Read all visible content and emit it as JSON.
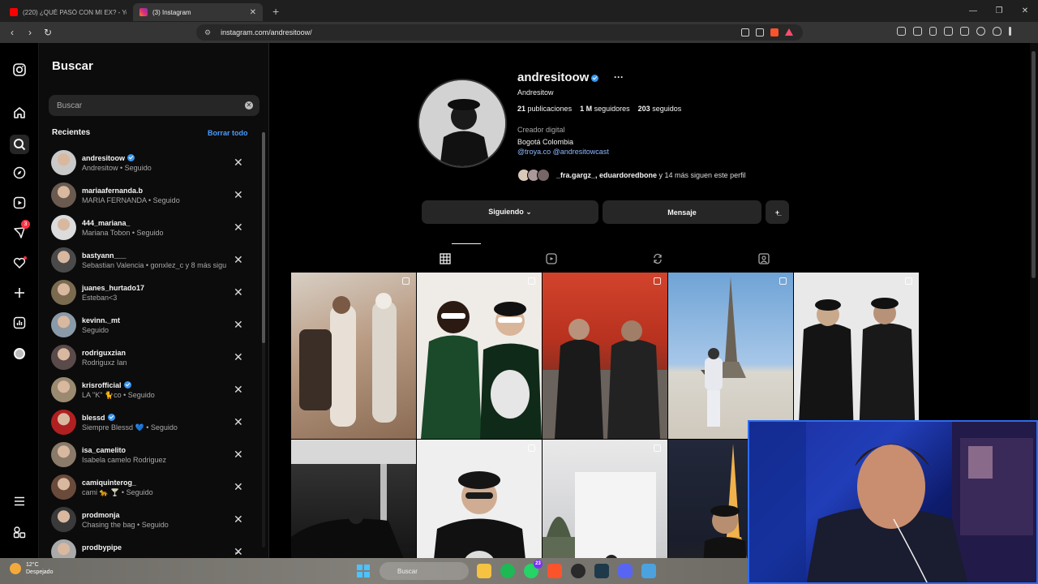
{
  "browser": {
    "tabs": [
      {
        "title": "(220) ¿QUÉ PASÓ CON MI EX? - YouTube",
        "fav_color": "#ff0000"
      },
      {
        "title": "(3) Instagram",
        "fav_color": "#e1306c"
      }
    ],
    "url": "instagram.com/andresitoow/"
  },
  "rail": {
    "notifications_badge": "3"
  },
  "search_panel": {
    "title": "Buscar",
    "placeholder": "Buscar",
    "recent_label": "Recientes",
    "clear_all": "Borrar todo",
    "items": [
      {
        "username": "andresitoow",
        "verified": true,
        "sub": "Andresitow • Seguido",
        "avatar": "#c9c9c9"
      },
      {
        "username": "mariaafernanda.b",
        "verified": false,
        "sub": "MARIA FERNANDA • Seguido",
        "avatar": "#6b5a4f"
      },
      {
        "username": "444_mariana_",
        "verified": false,
        "sub": "Mariana Tobon • Seguido",
        "avatar": "#dcdcdc"
      },
      {
        "username": "bastyann___",
        "verified": false,
        "sub": "Sebastian Valencia • gonxlez_c y 8 más siguen",
        "avatar": "#4a4a4a"
      },
      {
        "username": "juanes_hurtado17",
        "verified": false,
        "sub": "Esteban<3",
        "avatar": "#7a6a50"
      },
      {
        "username": "kevinn._mt",
        "verified": false,
        "sub": "Seguido",
        "avatar": "#8a9aa8"
      },
      {
        "username": "rodriguxzian",
        "verified": false,
        "sub": "Rodriguxz Ian",
        "avatar": "#5a4a4a"
      },
      {
        "username": "krisrofficial",
        "verified": true,
        "sub": "LA \"K\" 🐈co • Seguido",
        "avatar": "#9a8a70"
      },
      {
        "username": "blessd",
        "verified": true,
        "sub": "Siempre Blessd 💙 • Seguido",
        "avatar": "#b02020"
      },
      {
        "username": "isa_camelito",
        "verified": false,
        "sub": "Isabela camelo Rodriguez",
        "avatar": "#8a7a6a"
      },
      {
        "username": "camiquinterog_",
        "verified": false,
        "sub": "cami 🐆 🍸 • Seguido",
        "avatar": "#6a4a3a"
      },
      {
        "username": "prodmonja",
        "verified": false,
        "sub": "Chasing the bag • Seguido",
        "avatar": "#3a3a3a"
      },
      {
        "username": "prodbypipe",
        "verified": false,
        "sub": "",
        "avatar": "#aaaaaa"
      }
    ]
  },
  "profile": {
    "username": "andresitoow",
    "more": "···",
    "name": "Andresitow",
    "posts_count": "21",
    "posts_label": "publicaciones",
    "followers_count": "1 M",
    "followers_label": "seguidores",
    "following_count": "203",
    "following_label": "seguidos",
    "category": "Creador digital",
    "bio": "Bogotá Colombia",
    "links": "@troya.co @andresitowcast",
    "followed_by_names": "_fra.gargz_, eduardoredbone",
    "followed_by_rest": " y 14 más siguen este perfil",
    "btn_following": "Siguiendo ⌄",
    "btn_message": "Mensaje",
    "btn_add": "+̲"
  },
  "taskbar": {
    "temp": "12°C",
    "weather": "Despejado",
    "search": "Buscar",
    "discord_badge": "23"
  },
  "colors": {
    "accent_link": "#4a9bff",
    "verified": "#3897f0",
    "notification": "#ff3040"
  }
}
